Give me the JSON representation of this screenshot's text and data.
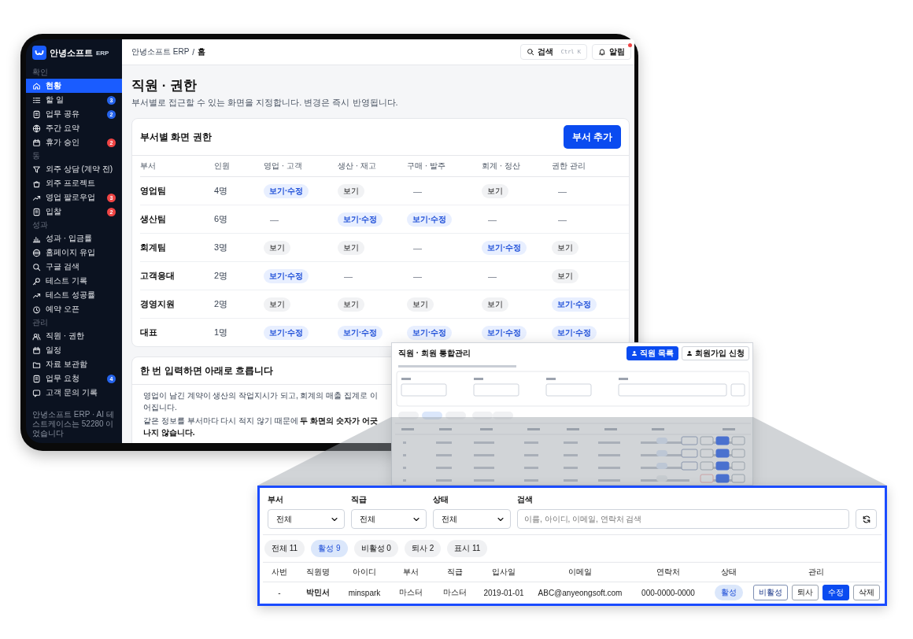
{
  "sidebar": {
    "brand": "안녕소프트",
    "brand_suffix": "ERP",
    "sections": [
      {
        "title": "확인",
        "items": [
          {
            "label": "현황",
            "selected": true
          },
          {
            "label": "할 일",
            "selected": false,
            "badge": {
              "text": "3",
              "color": "#2563eb"
            }
          },
          {
            "label": "업무 공유",
            "selected": false,
            "badge": {
              "text": "2",
              "color": "#2563eb"
            }
          },
          {
            "label": "주간 요약",
            "selected": false
          },
          {
            "label": "휴가 승인",
            "selected": false,
            "badge": {
              "text": "2",
              "color": "#ef4444"
            }
          }
        ]
      },
      {
        "title": "동",
        "items": [
          {
            "label": "외주 상담 (계약 전)",
            "selected": false
          },
          {
            "label": "외주 프로젝트",
            "selected": false
          },
          {
            "label": "영업 팔로우업",
            "selected": false,
            "badge": {
              "text": "3",
              "color": "#ef4444"
            }
          },
          {
            "label": "입찰",
            "selected": false,
            "badge": {
              "text": "2",
              "color": "#ef4444"
            }
          }
        ]
      },
      {
        "title": "성과",
        "items": [
          {
            "label": "성과 · 입금률",
            "selected": false
          },
          {
            "label": "홈페이지 유입",
            "selected": false
          },
          {
            "label": "구글 검색",
            "selected": false
          },
          {
            "label": "테스트 기록",
            "selected": false
          },
          {
            "label": "테스트 성공률",
            "selected": false
          },
          {
            "label": "예약 오픈",
            "selected": false
          }
        ]
      },
      {
        "title": "관리",
        "items": [
          {
            "label": "직원 · 권한",
            "selected": false
          },
          {
            "label": "일정",
            "selected": false
          },
          {
            "label": "자료 보관함",
            "selected": false
          },
          {
            "label": "업무 요청",
            "selected": false,
            "badge": {
              "text": "4",
              "color": "#2563eb"
            }
          },
          {
            "label": "고객 문의 기록",
            "selected": false
          }
        ]
      }
    ],
    "footer": "안녕소프트 ERP · AI 테스트케이스는 52280 이었습니다"
  },
  "topbar": {
    "breadcrumb": [
      "안녕소프트 ERP",
      "/",
      "홈"
    ],
    "search_label": "검색",
    "search_shortcut": "Ctrl K",
    "notify_label": "알림",
    "notify_unread": true
  },
  "page": {
    "title": "직원 · 권한",
    "subtitle": "부서별로 접근할 수 있는 화면을 지정합니다. 변경은 즉시 반영됩니다."
  },
  "permissions": {
    "title": "부서별 화면 권한",
    "add_button": "부서 추가",
    "columns": [
      "부서",
      "인원",
      "영업 · 고객",
      "생산 · 재고",
      "구매 · 발주",
      "회계 · 정산",
      "권한 관리"
    ],
    "rows": [
      {
        "cells": [
          {
            "text": "영업팀",
            "kind": "department"
          },
          {
            "text": "4명",
            "kind": "count"
          },
          {
            "text": "보기·수정",
            "kind": "edit"
          },
          {
            "text": "보기",
            "kind": "view"
          },
          {
            "text": "—",
            "kind": "none"
          },
          {
            "text": "보기",
            "kind": "view"
          },
          {
            "text": "—",
            "kind": "none"
          }
        ]
      },
      {
        "cells": [
          {
            "text": "생산팀",
            "kind": "department"
          },
          {
            "text": "6명",
            "kind": "count"
          },
          {
            "text": "—",
            "kind": "none"
          },
          {
            "text": "보기·수정",
            "kind": "edit"
          },
          {
            "text": "보기·수정",
            "kind": "edit"
          },
          {
            "text": "—",
            "kind": "none"
          },
          {
            "text": "—",
            "kind": "none"
          }
        ]
      },
      {
        "cells": [
          {
            "text": "회계팀",
            "kind": "department"
          },
          {
            "text": "3명",
            "kind": "count"
          },
          {
            "text": "보기",
            "kind": "view"
          },
          {
            "text": "보기",
            "kind": "view"
          },
          {
            "text": "—",
            "kind": "none"
          },
          {
            "text": "보기·수정",
            "kind": "edit"
          },
          {
            "text": "보기",
            "kind": "view"
          }
        ]
      },
      {
        "cells": [
          {
            "text": "고객응대",
            "kind": "department"
          },
          {
            "text": "2명",
            "kind": "count"
          },
          {
            "text": "보기·수정",
            "kind": "edit"
          },
          {
            "text": "—",
            "kind": "none"
          },
          {
            "text": "—",
            "kind": "none"
          },
          {
            "text": "—",
            "kind": "none"
          },
          {
            "text": "보기",
            "kind": "view"
          }
        ]
      },
      {
        "cells": [
          {
            "text": "경영지원",
            "kind": "department"
          },
          {
            "text": "2명",
            "kind": "count"
          },
          {
            "text": "보기",
            "kind": "view"
          },
          {
            "text": "보기",
            "kind": "view"
          },
          {
            "text": "보기",
            "kind": "view"
          },
          {
            "text": "보기",
            "kind": "view"
          },
          {
            "text": "보기·수정",
            "kind": "edit"
          }
        ]
      },
      {
        "cells": [
          {
            "text": "대표",
            "kind": "department"
          },
          {
            "text": "1명",
            "kind": "count"
          },
          {
            "text": "보기·수정",
            "kind": "edit"
          },
          {
            "text": "보기·수정",
            "kind": "edit"
          },
          {
            "text": "보기·수정",
            "kind": "edit"
          },
          {
            "text": "보기·수정",
            "kind": "edit"
          },
          {
            "text": "보기·수정",
            "kind": "edit"
          }
        ]
      }
    ]
  },
  "flow": {
    "title": "한 번 입력하면 아래로 흐릅니다",
    "paragraphs": [
      "영업이 남긴 계약이 생산의 작업지시가 되고, 회계의 매출 집계로 이어집니다.",
      "같은 정보를 부서마다 다시 적지 않기 때문에 **두 화면의 숫자가 어긋나지 않습니다.**"
    ]
  },
  "member_preview": {
    "title": "직원 · 회원 통합관리",
    "buttons": [
      {
        "label": "직원 목록",
        "kind": "primary"
      },
      {
        "label": "회원가입 신청",
        "kind": "secondary"
      }
    ]
  },
  "member_zoom": {
    "filters": [
      {
        "label": "부서",
        "value": "전체"
      },
      {
        "label": "직급",
        "value": "전체"
      },
      {
        "label": "상태",
        "value": "전체"
      }
    ],
    "search": {
      "label": "검색",
      "placeholder": "이름, 아이디, 이메일, 연락처 검색"
    },
    "tabs": [
      {
        "label": "전체 11",
        "selected": false
      },
      {
        "label": "활성 9",
        "selected": true
      },
      {
        "label": "비활성 0",
        "selected": false
      },
      {
        "label": "퇴사 2",
        "selected": false
      },
      {
        "label": "표시 11",
        "selected": false
      }
    ],
    "columns": [
      "사번",
      "직원명",
      "아이디",
      "부서",
      "직급",
      "입사일",
      "이메일",
      "연락처",
      "상태",
      "관리"
    ],
    "rows": [
      {
        "cells": [
          "-",
          "박민서",
          "minspark",
          "마스터",
          "마스터",
          "2019-01-01",
          "ABC@anyeongsoft.com",
          "000-0000-0000"
        ],
        "status": {
          "text": "활성",
          "kind": "active"
        },
        "actions": [
          {
            "label": "비활성",
            "kind": "outline"
          },
          {
            "label": "퇴사",
            "kind": "neutral"
          },
          {
            "label": "수정",
            "kind": "primary"
          },
          {
            "label": "삭제",
            "kind": "neutral"
          }
        ]
      }
    ]
  }
}
